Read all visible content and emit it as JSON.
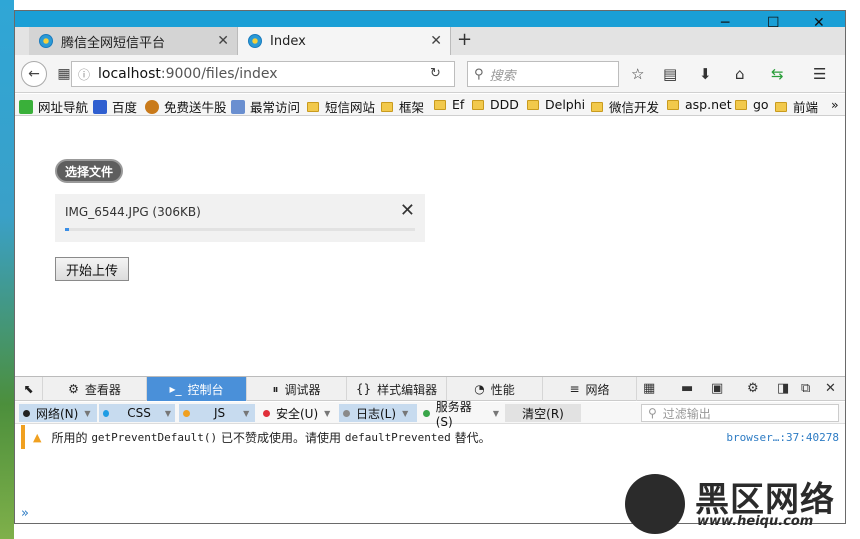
{
  "browser": {
    "tabs": [
      {
        "title": "腾信全网短信平台"
      },
      {
        "title": "Index"
      }
    ],
    "url": {
      "host": "localhost",
      "rest": ":9000/files/index"
    },
    "search_placeholder": "搜索",
    "bookmarks": [
      "网址导航",
      "百度",
      "免费送牛股",
      "最常访问",
      "短信网站",
      "框架",
      "Ef",
      "DDD",
      "Delphi",
      "微信开发",
      "asp.net",
      "go",
      "前端"
    ],
    "overflow": "»"
  },
  "page": {
    "pick_button": "选择文件",
    "file": {
      "name": "IMG_6544.JPG (306KB)",
      "progress": 0.005
    },
    "upload_button": "开始上传"
  },
  "devtools": {
    "tabs": [
      "查看器",
      "控制台",
      "调试器",
      "样式编辑器",
      "性能",
      "网络"
    ],
    "filters": [
      {
        "label": "网络(N)",
        "color": "#222222"
      },
      {
        "label": "CSS",
        "color": "#1e9ce4"
      },
      {
        "label": "JS",
        "color": "#f0a020"
      },
      {
        "label": "安全(U)",
        "color": "#e0303a"
      },
      {
        "label": "日志(L)",
        "color": "#8a8a8a"
      },
      {
        "label": "服务器(S)",
        "color": "#3aa64a"
      }
    ],
    "clear": "清空(R)",
    "filter_output": "过滤输出",
    "message": {
      "text1": "所用的",
      "code1": "getPreventDefault()",
      "text2": "已不赞成使用。请使用",
      "code2": "defaultPrevented",
      "text3": "替代。",
      "source": "browser…:37:40278"
    },
    "prompt": "»"
  },
  "watermark": {
    "brand": "黑区网络",
    "url": "www.heiqu.com"
  }
}
